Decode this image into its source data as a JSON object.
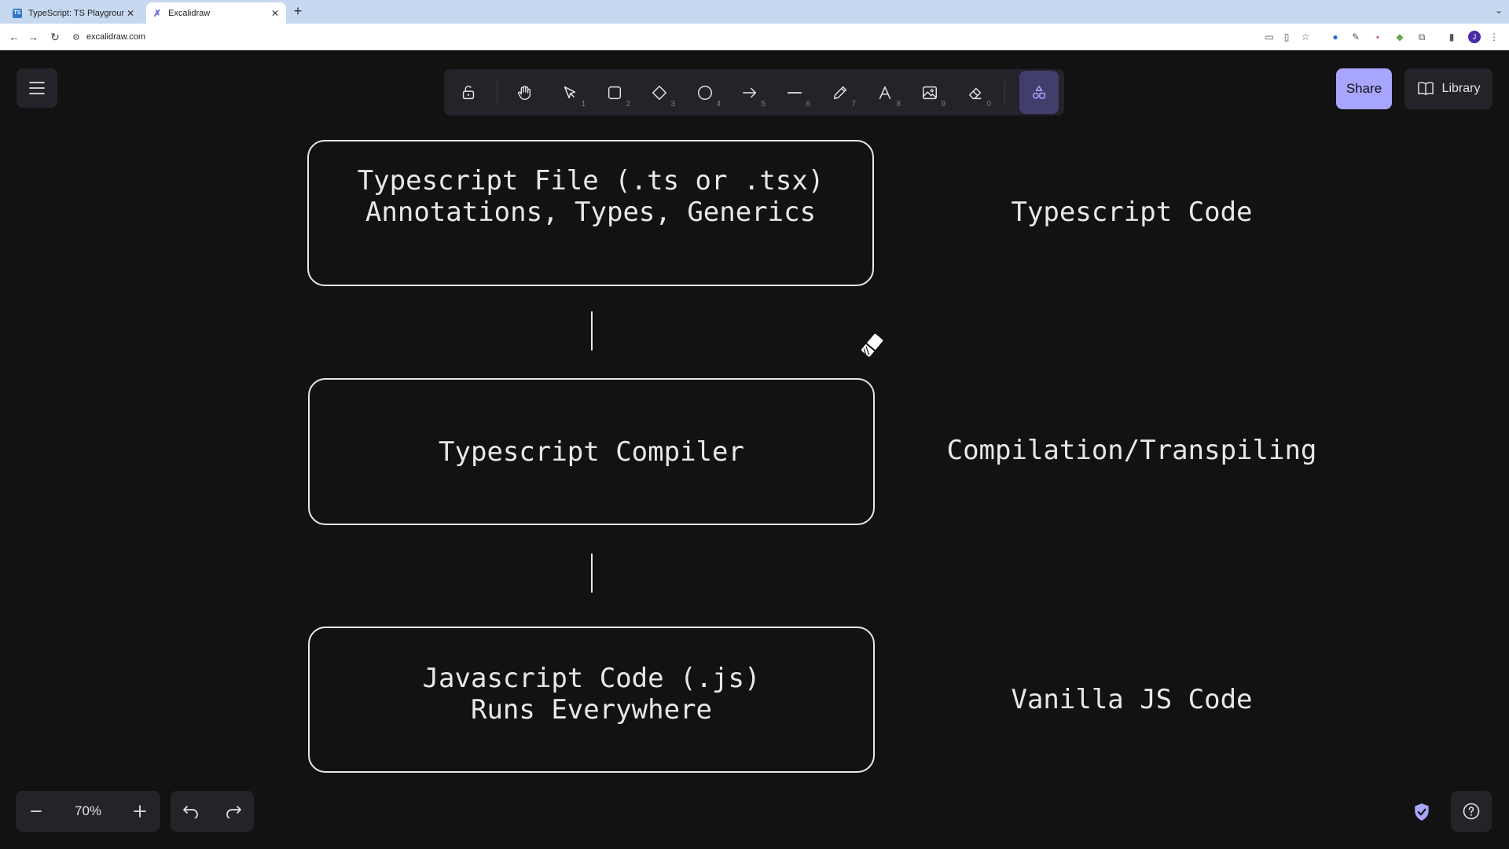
{
  "browser": {
    "tabs": [
      {
        "title": "TypeScript: TS Playground - A",
        "favicon": "TS",
        "active": false
      },
      {
        "title": "Excalidraw",
        "favicon": "excalidraw-icon",
        "active": true
      }
    ],
    "new_tab": "+",
    "url": "excalidraw.com"
  },
  "toolbar": {
    "tools": [
      {
        "name": "lock",
        "key": ""
      },
      {
        "name": "hand",
        "key": ""
      },
      {
        "name": "selection",
        "key": "1"
      },
      {
        "name": "rectangle",
        "key": "2"
      },
      {
        "name": "diamond",
        "key": "3"
      },
      {
        "name": "ellipse",
        "key": "4"
      },
      {
        "name": "arrow",
        "key": "5"
      },
      {
        "name": "line",
        "key": "6"
      },
      {
        "name": "draw",
        "key": "7"
      },
      {
        "name": "text",
        "key": "8"
      },
      {
        "name": "image",
        "key": "9"
      },
      {
        "name": "eraser",
        "key": "0"
      },
      {
        "name": "extra-tools",
        "key": ""
      }
    ]
  },
  "header": {
    "share_label": "Share",
    "library_label": "Library"
  },
  "diagram": {
    "boxes": [
      {
        "lines": [
          "Typescript File (.ts or .tsx)",
          "Annotations, Types, Generics"
        ]
      },
      {
        "lines": [
          "Typescript Compiler"
        ]
      },
      {
        "lines": [
          "Javascript Code (.js)",
          "Runs Everywhere"
        ]
      }
    ],
    "labels": [
      "Typescript Code",
      "Compilation/Transpiling",
      "Vanilla JS Code"
    ]
  },
  "footer": {
    "zoom_level": "70%"
  },
  "colors": {
    "canvas": "#121212",
    "panel": "#232329",
    "accent": "#a8a5ff",
    "stroke": "#e8e8e8"
  }
}
